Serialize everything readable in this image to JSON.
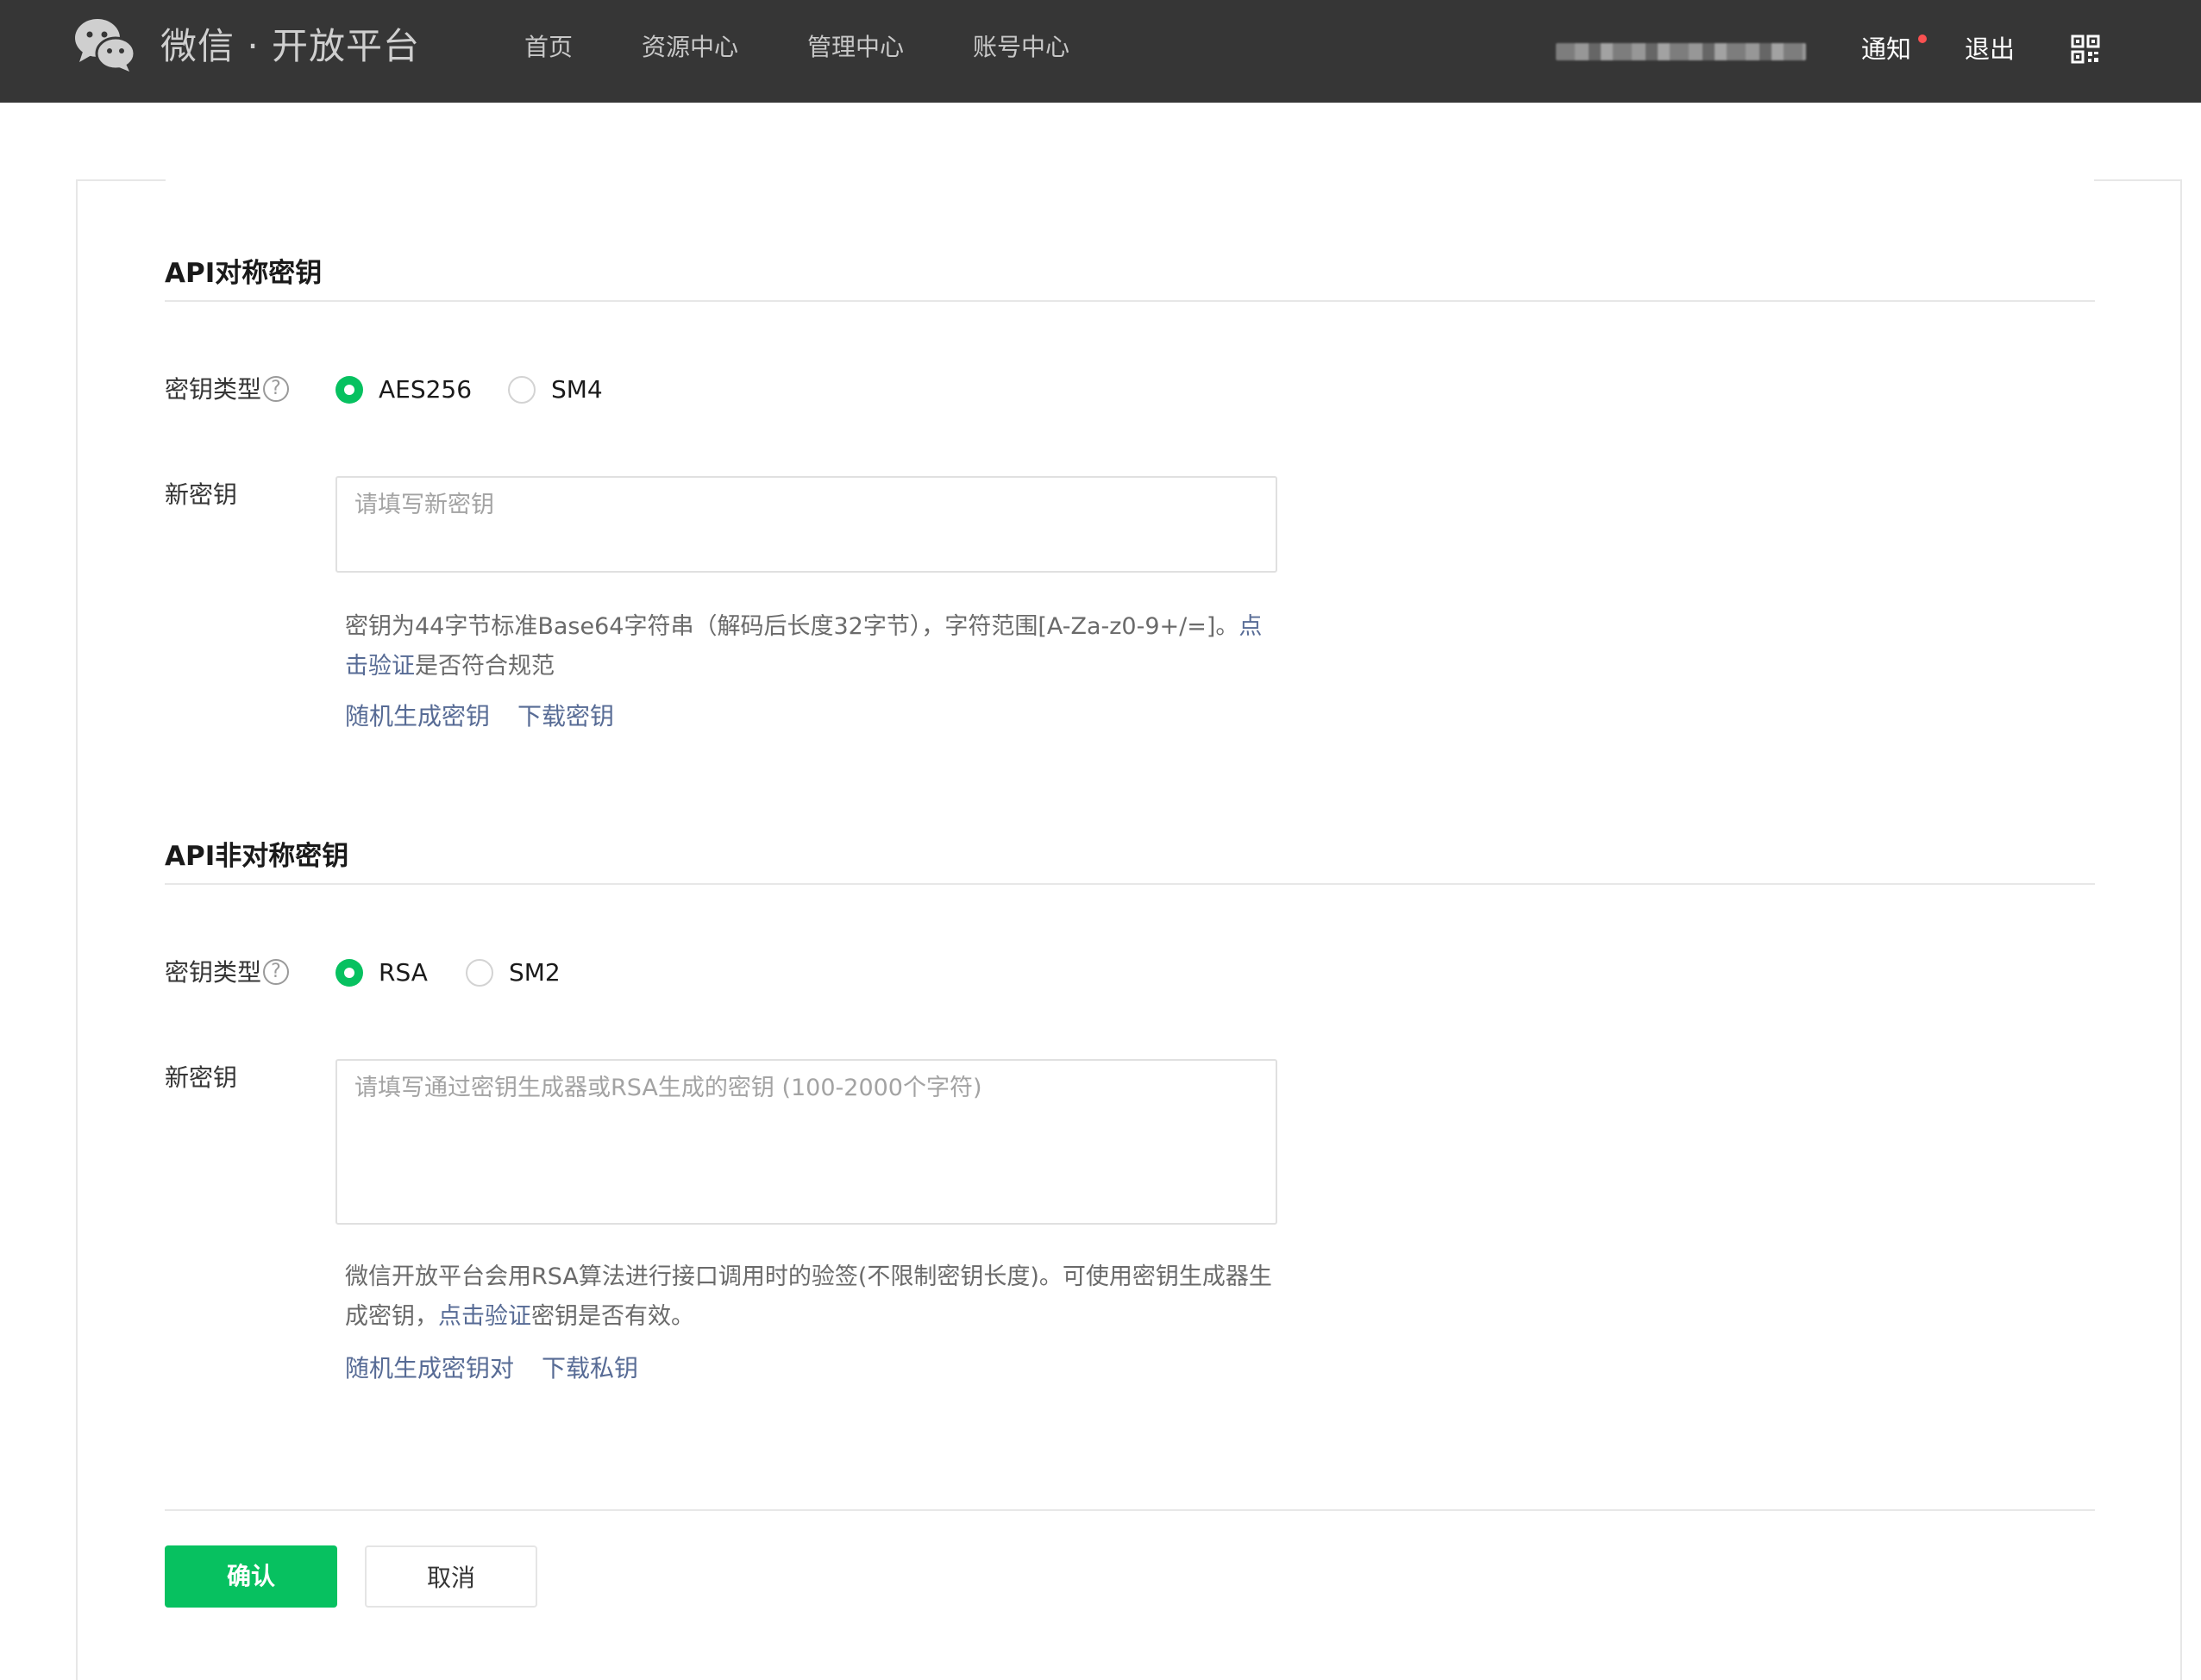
{
  "header": {
    "brand": "微信 · 开放平台",
    "nav": [
      "首页",
      "资源中心",
      "管理中心",
      "账号中心"
    ],
    "notify_label": "通知",
    "logout_label": "退出",
    "icons": {
      "logo": "wechat-logo-icon",
      "qr": "qrcode-icon"
    },
    "colors": {
      "bar": "#363636",
      "notify_dot": "#fa5151"
    }
  },
  "symmetric": {
    "title": "API对称密钥",
    "type_label": "密钥类型",
    "help": "?",
    "options": [
      "AES256",
      "SM4"
    ],
    "selected": "AES256",
    "key_label": "新密钥",
    "key_value": "",
    "placeholder": "请填写新密钥",
    "desc_text": "密钥为44字节标准Base64字符串（解码后长度32字节），字符范围[A-Za-z0-9+/=]。",
    "desc_link": "点击验证",
    "desc_suffix": "是否符合规范",
    "actions": [
      "随机生成密钥",
      "下载密钥"
    ]
  },
  "asymmetric": {
    "title": "API非对称密钥",
    "type_label": "密钥类型",
    "help": "?",
    "options": [
      "RSA",
      "SM2"
    ],
    "selected": "RSA",
    "key_label": "新密钥",
    "key_value": "",
    "placeholder": "请填写通过密钥生成器或RSA生成的密钥 (100-2000个字符)",
    "desc_text": "微信开放平台会用RSA算法进行接口调用时的验签(不限制密钥长度)。可使用密钥生成器生成密钥，",
    "desc_link": "点击验证",
    "desc_suffix": "密钥是否有效。",
    "actions": [
      "随机生成密钥对",
      "下载私钥"
    ]
  },
  "footer": {
    "confirm_label": "确认",
    "cancel_label": "取消",
    "colors": {
      "primary": "#07c160",
      "link": "#576b95"
    }
  }
}
